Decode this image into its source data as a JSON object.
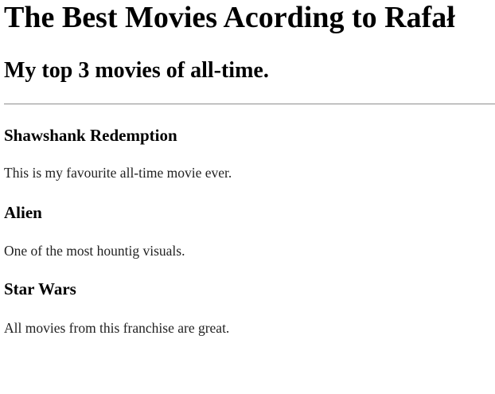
{
  "page": {
    "title": "The Best Movies Acording to Rafał",
    "subtitle": "My top 3 movies of all-time."
  },
  "movies": [
    {
      "title": "Shawshank Redemption",
      "description": "This is my favourite all-time movie ever."
    },
    {
      "title": "Alien",
      "description": "One of the most hountig visuals."
    },
    {
      "title": "Star Wars",
      "description": "All movies from this franchise are great."
    }
  ]
}
